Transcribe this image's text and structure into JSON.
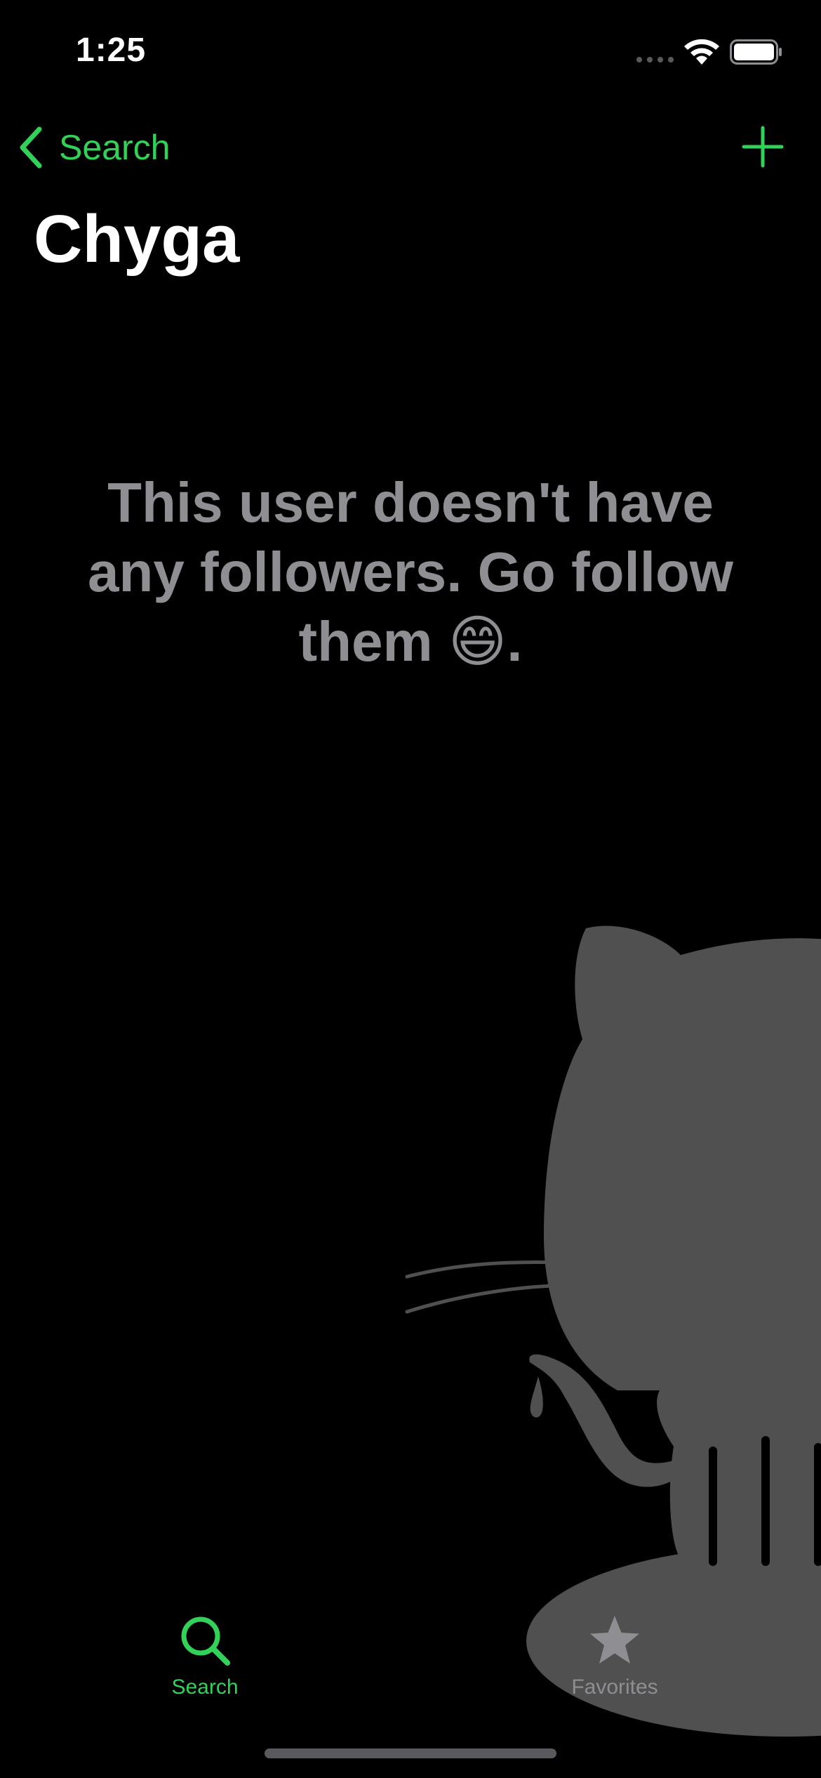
{
  "status_bar": {
    "time": "1:25"
  },
  "nav": {
    "back_label": "Search",
    "title": "Chyga"
  },
  "empty_state": {
    "message": "This user doesn't have any followers. Go follow them 😄."
  },
  "tab_bar": {
    "items": [
      {
        "label": "Search",
        "icon": "search-icon",
        "selected": true
      },
      {
        "label": "Favorites",
        "icon": "star-icon",
        "selected": false
      }
    ]
  },
  "colors": {
    "accent": "#32d158",
    "background": "#000000",
    "secondary_text": "#8e8e93",
    "silhouette": "#505050"
  }
}
